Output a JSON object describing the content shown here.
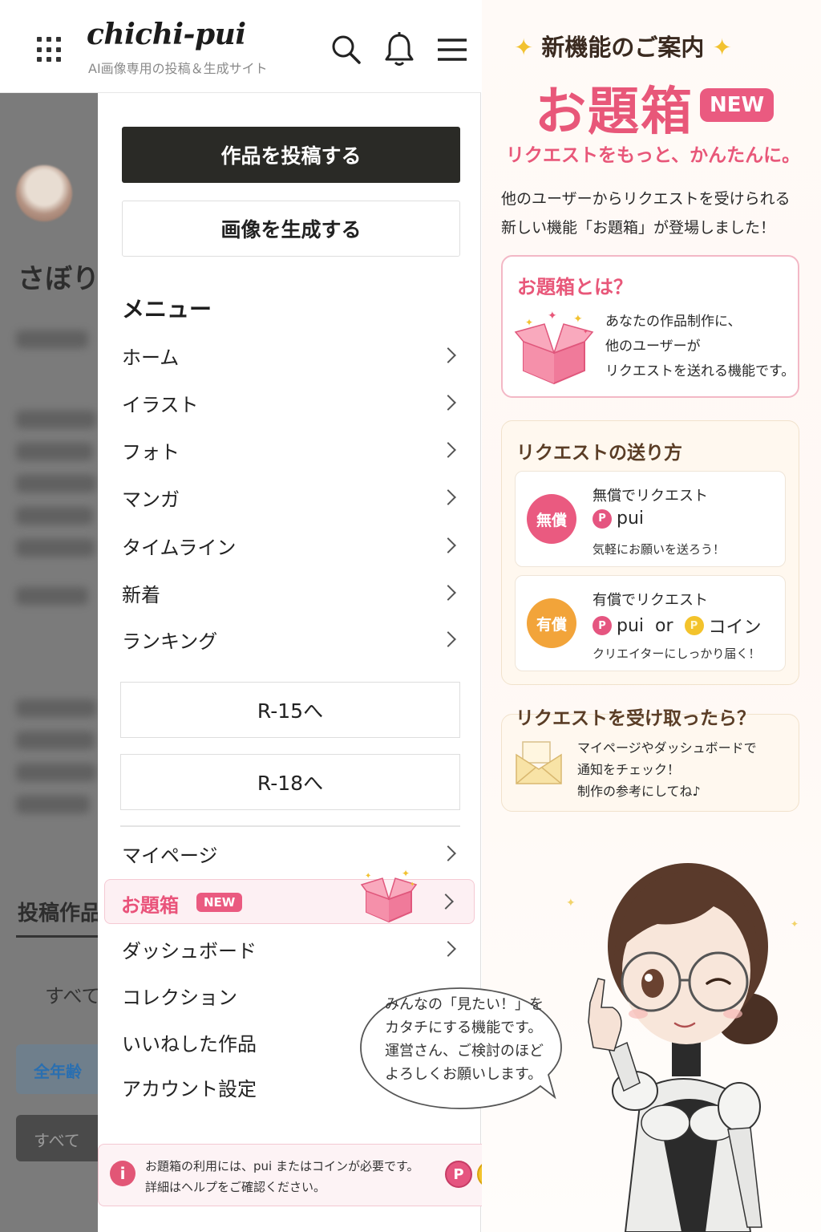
{
  "header": {
    "logo": "chichi-pui",
    "tagline": "AI画像専用の投稿＆生成サイト"
  },
  "background_page": {
    "title": "さぼり",
    "section": "投稿作品",
    "tab": "すべて",
    "chip": "全年齢",
    "button": "すべて"
  },
  "drawer": {
    "post_button": "作品を投稿する",
    "generate_button": "画像を生成する",
    "menu_heading": "メニュー",
    "menu_items": [
      {
        "label": "ホーム"
      },
      {
        "label": "イラスト"
      },
      {
        "label": "フォト"
      },
      {
        "label": "マンガ"
      },
      {
        "label": "タイムライン"
      },
      {
        "label": "新着"
      },
      {
        "label": "ランキング"
      }
    ],
    "r15_button": "R-15へ",
    "r18_button": "R-18へ",
    "mypage": "マイページ",
    "odai": {
      "label": "お題箱",
      "badge": "NEW"
    },
    "dashboard": "ダッシュボード",
    "collection": "コレクション",
    "liked": "いいねした作品",
    "account": "アカウント設定",
    "notice": {
      "line1": "お題箱の利用には、pui またはコインが必要です。",
      "line2": "詳細はヘルプをご確認ください。",
      "info_icon": "i",
      "pui_coin": "P",
      "gold_coin": "P"
    }
  },
  "promo": {
    "heading": "新機能のご案内",
    "title": "お題箱",
    "badge": "NEW",
    "subtitle": "リクエストをもっと、かんたんに。",
    "desc_line1": "他のユーザーからリクエストを受けられる",
    "desc_line2": "新しい機能「お題箱」が登場しました！",
    "what": {
      "title": "お題箱とは？",
      "line1": "あなたの作品制作に、",
      "line2": "他のユーザーが",
      "line3": "リクエストを送れる機能です。"
    },
    "how": {
      "title": "リクエストの送り方",
      "free": {
        "badge": "無償",
        "label": "無償でリクエスト",
        "currency": "pui",
        "coin_glyph": "P",
        "note": "気軽にお願いを送ろう！"
      },
      "paid": {
        "badge": "有償",
        "label": "有償でリクエスト",
        "currency1": "pui",
        "or": "or",
        "currency2": "コイン",
        "coin_glyph": "P",
        "note": "クリエイターにしっかり届く！"
      }
    },
    "after": {
      "title": "リクエストを受け取ったら？",
      "line1": "マイページやダッシュボードで",
      "line2": "通知をチェック！",
      "line3": "制作の参考にしてね♪"
    },
    "bubble": {
      "line1": "みんなの「見たい！」を",
      "line2": "カタチにする機能です。",
      "line3": "運営さん、ご検討のほど",
      "line4": "よろしくお願いします。"
    }
  },
  "colors": {
    "accent_pink": "#e85779",
    "dark_button": "#2a2a26",
    "free_badge": "#ea5a80",
    "paid_badge": "#f2a43a"
  }
}
